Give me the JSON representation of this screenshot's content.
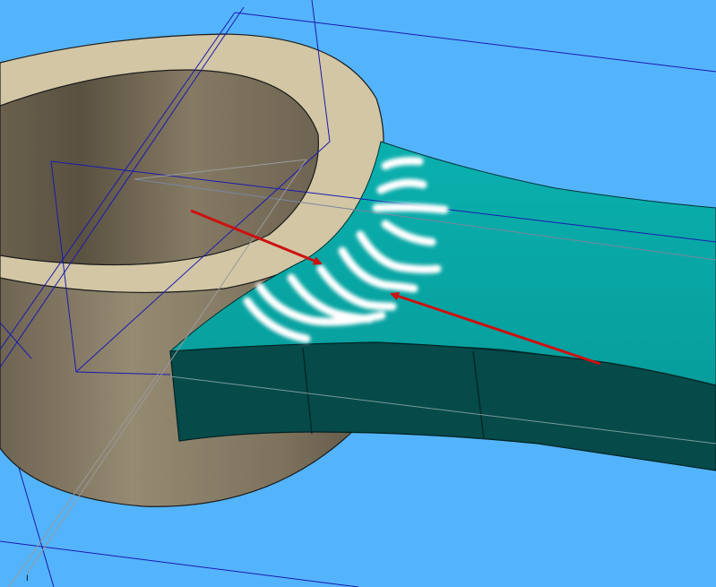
{
  "scene": {
    "background": "#54b4fb",
    "boss_color": "#8a7c63",
    "boss_top_face_color": "#d2c6a4",
    "arm_top_color": "#0aa6a6",
    "arm_side_color": "#064a4a",
    "sketch_line_color": "#1a1ab0",
    "arrow_color": "#cc1111",
    "annotation_stroke_color": "#ffffff"
  },
  "icons": {
    "triad": "coordinate-axis-icon"
  },
  "axis": {
    "label": "I"
  }
}
